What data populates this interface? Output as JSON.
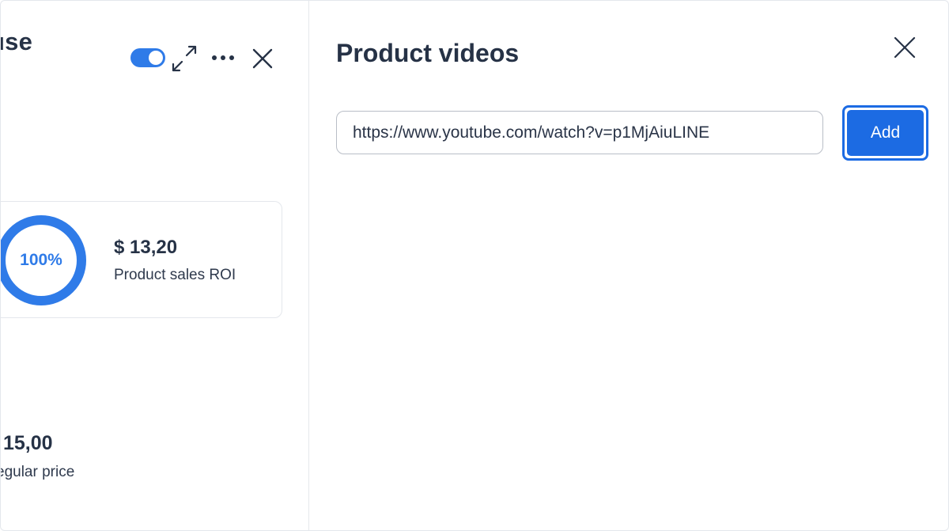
{
  "left_panel": {
    "title_fragment": "use",
    "toolbar": {
      "toggle_icon": "toggle-on",
      "expand_icon": "expand-arrows-icon",
      "more_icon": "more-dots-icon",
      "close_icon": "close-icon"
    },
    "stat_card": {
      "ring_percent_label": "100%",
      "ring_fill_percent": 100,
      "value": "$ 13,20",
      "label": "Product sales ROI"
    },
    "price": {
      "value": "15,00",
      "label": "egular price"
    }
  },
  "dialog": {
    "title": "Product videos",
    "close_icon": "close-icon",
    "url_input": {
      "value": "https://www.youtube.com/watch?v=p1MjAiuLINE"
    },
    "add_button_label": "Add"
  },
  "colors": {
    "accent": "#2f7be8",
    "button": "#1c6be3",
    "heading": "#263246",
    "border": "#e4e7ec"
  }
}
